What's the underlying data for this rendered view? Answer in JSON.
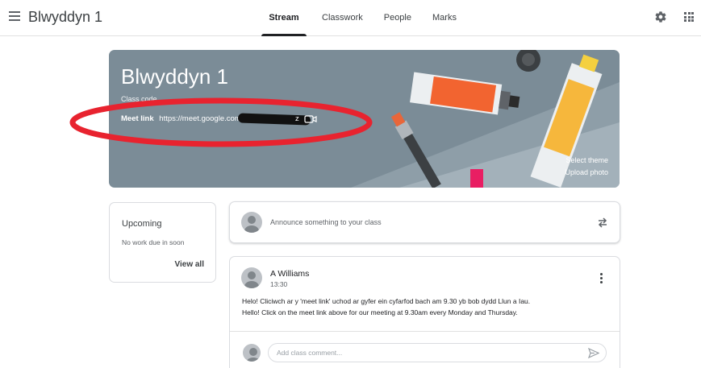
{
  "header": {
    "app_title": "Blwyddyn 1",
    "menu_icon": "hamburger-menu-icon",
    "tabs": [
      {
        "label": "Stream",
        "active": true
      },
      {
        "label": "Classwork",
        "active": false
      },
      {
        "label": "People",
        "active": false
      },
      {
        "label": "Marks",
        "active": false
      }
    ],
    "settings_icon": "gear-icon",
    "apps_icon": "apps-grid-icon"
  },
  "banner": {
    "title": "Blwyddyn 1",
    "class_code_label": "Class code",
    "meet_label": "Meet link",
    "meet_url": "https://meet.google.com",
    "meet_url_suffix": "z",
    "select_theme": "Select theme",
    "upload_photo": "Upload photo",
    "background_color": "#7b8c97"
  },
  "upcoming": {
    "title": "Upcoming",
    "empty_text": "No work due in soon",
    "view_all": "View all"
  },
  "announce": {
    "placeholder": "Announce something to your class"
  },
  "post": {
    "author": "A Williams",
    "time": "13:30",
    "line1": "Helo! Cliciwch ar y 'meet link' uchod ar gyfer ein cyfarfod bach am 9.30 yb bob dydd Llun a Iau.",
    "line2": "Hello! Click on the meet link above for our meeting at 9.30am every Monday and Thursday.",
    "comment_placeholder": "Add class comment..."
  },
  "colors": {
    "annotation_red": "#e8232f",
    "accent_dark": "#202124"
  }
}
